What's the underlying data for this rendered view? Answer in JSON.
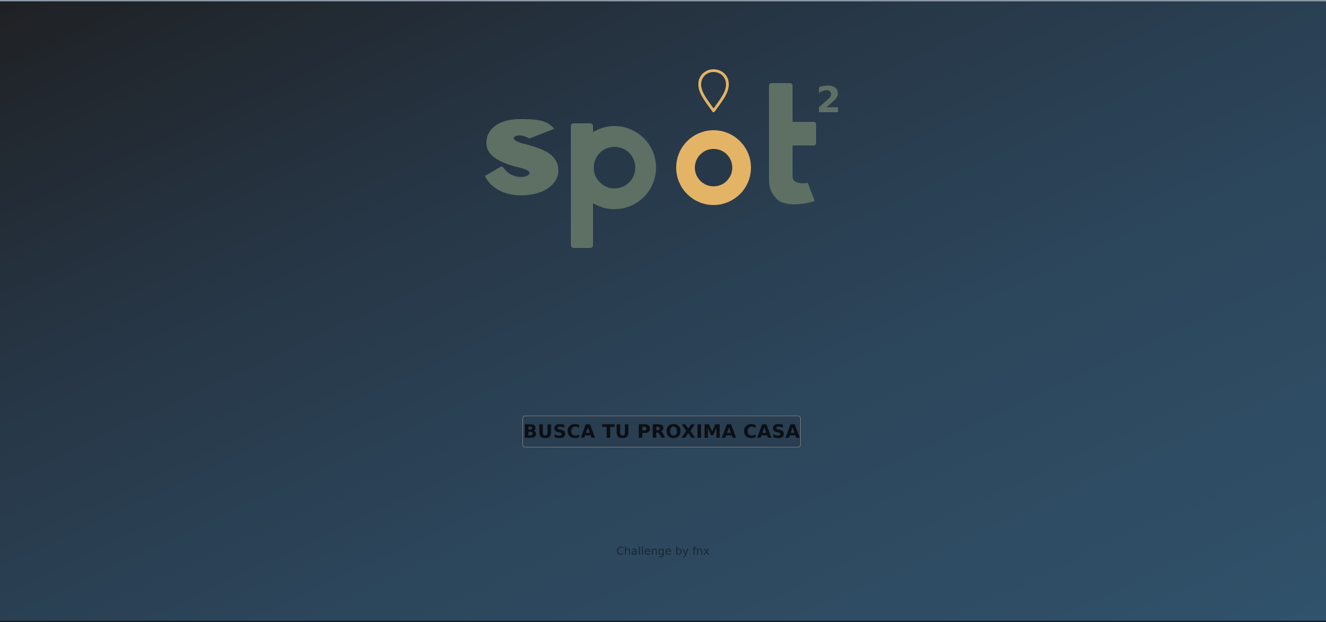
{
  "brand": {
    "name": "spot2",
    "logo_text": "spot",
    "logo_superscript": "2",
    "colors": {
      "letters": "#5e7064",
      "accent": "#e4b466"
    },
    "icons": {
      "pin": "map-pin-icon"
    }
  },
  "main": {
    "cta_label": "BUSCA TU PROXIMA CASA"
  },
  "footer": {
    "credit": "Challenge by fnx"
  },
  "theme": {
    "background_start": "#1f2124",
    "background_end": "#30526b",
    "button_border": "#6a727c"
  }
}
